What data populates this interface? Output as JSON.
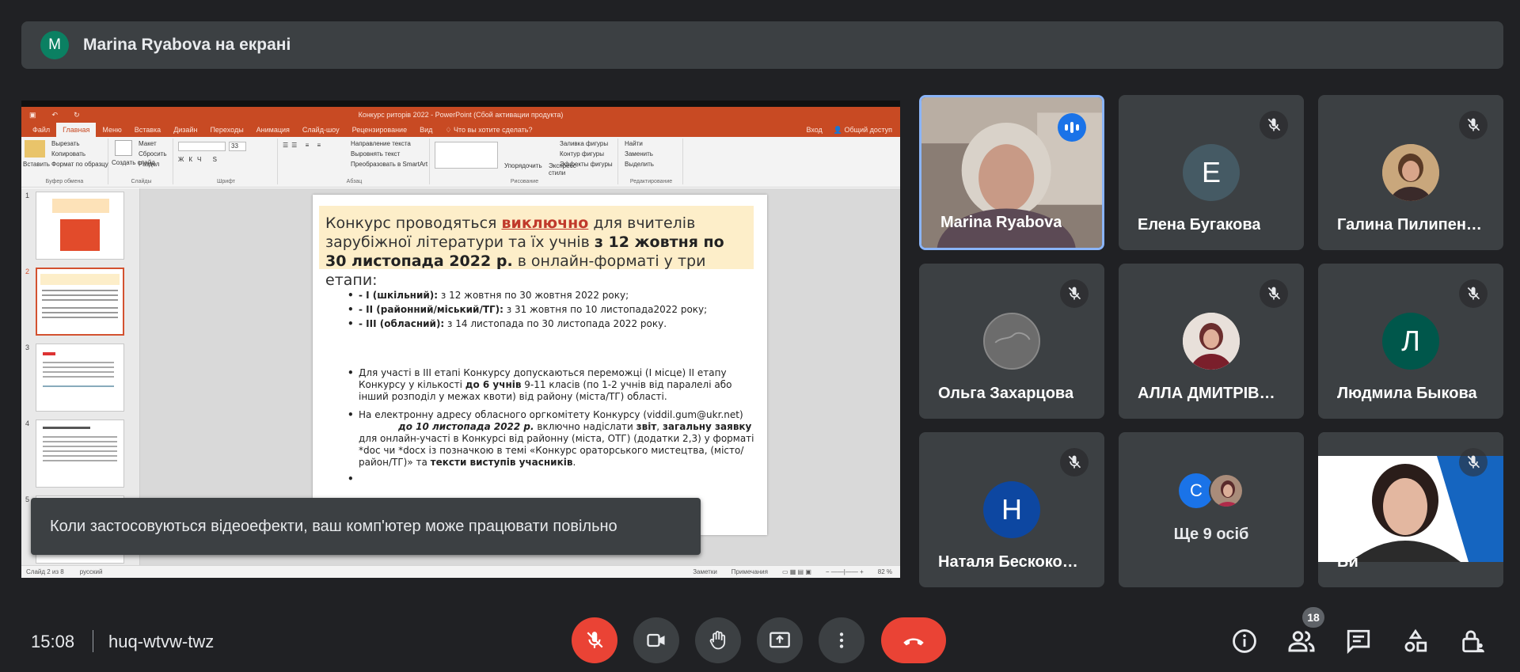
{
  "topbar": {
    "avatar_letter": "M",
    "presenter_label": "Marina Ryabova на екрані"
  },
  "ppt": {
    "window_title": "Конкурс риторів 2022 - PowerPoint (Сбой активации продукта)",
    "tabs": [
      "Файл",
      "Главная",
      "Меню",
      "Вставка",
      "Дизайн",
      "Переходы",
      "Анимация",
      "Слайд-шоу",
      "Рецензирование",
      "Вид"
    ],
    "tell_me": "Что вы хотите сделать?",
    "sign_in": "Вход",
    "share": "Общий доступ",
    "ribbon": {
      "paste": "Вставить",
      "cut": "Вырезать",
      "copy": "Копировать",
      "format_painter": "Формат по образцу",
      "clipboard": "Буфер обмена",
      "new_slide": "Создать слайд",
      "layout": "Макет",
      "reset": "Сбросить",
      "section": "Раздел",
      "slides": "Слайды",
      "font": "Шрифт",
      "font_size": "33",
      "text_direction": "Направление текста",
      "align_text": "Выровнять текст",
      "smartart": "Преобразовать в SmartArt",
      "paragraph": "Абзац",
      "arrange": "Упорядочить",
      "quick_styles": "Экспресс-стили",
      "shape_fill": "Заливка фигуры",
      "shape_outline": "Контур фигуры",
      "shape_effects": "Эффекты фигуры",
      "drawing": "Рисование",
      "find": "Найти",
      "replace": "Заменить",
      "select": "Выделить",
      "editing": "Редактирование"
    },
    "thumb_numbers": [
      "1",
      "2",
      "3",
      "4",
      "5"
    ],
    "slide": {
      "head_part1": "Конкурс проводяться ",
      "head_highlight": "виключно",
      "head_part2": " для вчителів зарубіжної літератури та їх учнів ",
      "head_bold": "з 12 жовтня по 30 листопада 2022 р.",
      "head_part3": " в онлайн-форматі у три етапи:",
      "stages": [
        {
          "bold": "- І (шкільний):",
          "text": " з 12 жовтня по 30 жовтня 2022 року;"
        },
        {
          "bold": "- ІІ (районний/міський/ТГ):",
          "text": " з 31 жовтня  по 10 листопада2022 року;"
        },
        {
          "bold": "- ІІІ (обласний):",
          "text": " з 14 листопада по 30 листопада 2022 року."
        }
      ],
      "p1_a": "Для участі в ІІІ етапі Конкурсу допускаються переможці (І місце) ІІ етапу Конкурсу у кількості ",
      "p1_bold": "до 6 учнів",
      "p1_b": " 9-11 класів (по 1-2 учнів від паралелі або інший розподіл у межах квоти) від району (міста/ТГ) області.",
      "p2_a": "На електронну адресу обласного оргкомітету Конкурсу (viddil.gum@ukr.net)",
      "p2_date": "до 10  листопада 2022 р.",
      "p2_b": " включно надіслати ",
      "p2_bold1": "звіт",
      "p2_c": ",  ",
      "p2_bold2": "загальну заявку",
      "p2_d": " для онлайн-участі в Конкурсі від районну (міста, ОТГ) (додатки 2,3) у форматі *doc чи *docx  із позначкою в темі «Конкурс ораторського мистецтва, (місто/район/ТГ)» та ",
      "p2_bold3": "тексти виступів учасників",
      "p2_e": "."
    },
    "status_slide": "Слайд 2 из 8",
    "status_lang": "русский",
    "notes": "Заметки",
    "comments": "Примечания",
    "zoom": "82 %"
  },
  "toast": "Коли застосовуються відеоефекти, ваш комп'ютер може працювати повільно",
  "participants": [
    {
      "name": "Marina Ryabova"
    },
    {
      "name": "Елена Бугакова",
      "letter": "Е",
      "color": "#455a64"
    },
    {
      "name": "Галина Пилипен…"
    },
    {
      "name": "Ольга Захарцова"
    },
    {
      "name": "АЛЛА ДМИТРІВ…"
    },
    {
      "name": "Людмила Быкова",
      "letter": "Л",
      "color": "#00574b"
    },
    {
      "name": "Наталя Бескоко…",
      "letter": "Н",
      "color": "#0d47a1"
    },
    {
      "name": "Ще 9 осіб",
      "letter": "С",
      "color": "#1a73e8"
    },
    {
      "name": "Ви"
    }
  ],
  "bottombar": {
    "time": "15:08",
    "meeting_code": "huq-wtvw-twz",
    "participant_count": "18"
  },
  "colors": {
    "background": "#202124",
    "tile": "#3c4043",
    "red": "#ea4335",
    "active_border": "#8ab4f8",
    "ppt_accent": "#c84a23"
  }
}
